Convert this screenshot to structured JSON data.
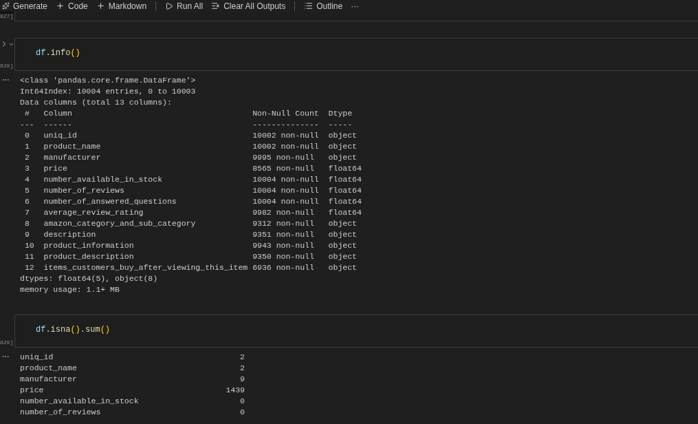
{
  "toolbar": [
    {
      "kind": "generate",
      "label": "Generate"
    },
    {
      "kind": "add",
      "label": "Code"
    },
    {
      "kind": "add",
      "label": "Markdown"
    },
    {
      "kind": "separator"
    },
    {
      "kind": "run",
      "label": "Run All"
    },
    {
      "kind": "clear",
      "label": "Clear All Outputs"
    },
    {
      "kind": "separator"
    },
    {
      "kind": "outline",
      "label": "Outline"
    },
    {
      "kind": "more",
      "label": "···"
    }
  ],
  "cells": [
    {
      "count": "827]"
    },
    {
      "count": "828]",
      "run_button": true,
      "code": [
        {
          "text": "df",
          "kind": "var"
        },
        {
          "text": ".",
          "kind": "plain"
        },
        {
          "text": "info",
          "kind": "func"
        },
        {
          "text": "()",
          "kind": "paren"
        }
      ],
      "output": {
        "kind": "text",
        "lines": [
          "<class 'pandas.core.frame.DataFrame'>",
          "Int64Index: 10004 entries, 0 to 10003",
          "Data columns (total 13 columns):",
          " #   Column                                      Non-Null Count  Dtype  ",
          "---  ------                                      --------------  -----  ",
          " 0   uniq_id                                     10002 non-null  object ",
          " 1   product_name                                10002 non-null  object ",
          " 2   manufacturer                                9995 non-null   object ",
          " 3   price                                       8565 non-null   float64",
          " 4   number_available_in_stock                   10004 non-null  float64",
          " 5   number_of_reviews                           10004 non-null  float64",
          " 6   number_of_answered_questions                10004 non-null  float64",
          " 7   average_review_rating                       9982 non-null   float64",
          " 8   amazon_category_and_sub_category            9312 non-null   object ",
          " 9   description                                 9351 non-null   object ",
          " 10  product_information                         9943 non-null   object ",
          " 11  product_description                         9350 non-null   object ",
          " 12  items_customers_buy_after_viewing_this_item 6936 non-null   object ",
          "dtypes: float64(5), object(8)",
          "memory usage: 1.1+ MB"
        ]
      }
    },
    {
      "count": "829]",
      "run_button": false,
      "code": [
        {
          "text": "df",
          "kind": "var"
        },
        {
          "text": ".",
          "kind": "plain"
        },
        {
          "text": "isna",
          "kind": "func"
        },
        {
          "text": "()",
          "kind": "paren"
        },
        {
          "text": ".",
          "kind": "plain"
        },
        {
          "text": "sum",
          "kind": "func"
        },
        {
          "text": "()",
          "kind": "paren"
        }
      ],
      "output": {
        "kind": "series",
        "rows": [
          {
            "name": "uniq_id",
            "value": "2"
          },
          {
            "name": "product_name",
            "value": "2"
          },
          {
            "name": "manufacturer",
            "value": "9"
          },
          {
            "name": "price",
            "value": "1439"
          },
          {
            "name": "number_available_in_stock",
            "value": "0"
          },
          {
            "name": "number_of_reviews",
            "value": "0"
          }
        ]
      }
    }
  ]
}
